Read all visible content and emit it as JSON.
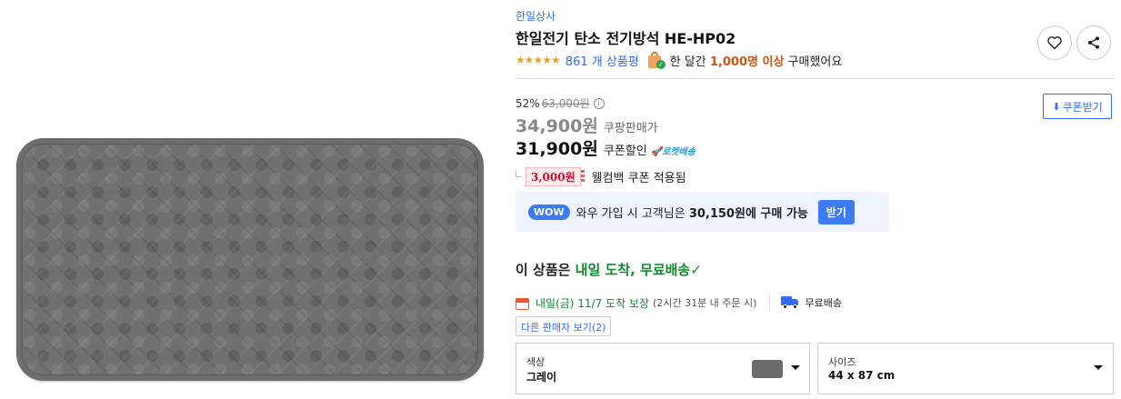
{
  "product": {
    "brand": "한일상사",
    "title": "한일전기 탄소 전기방석 HE-HP02",
    "rating_stars": "★★★★★",
    "review_count": "861 개 상품평",
    "purchase_prefix": "한 달간",
    "purchase_highlight": "1,000명 이상",
    "purchase_suffix": "구매했어요"
  },
  "actions": {
    "wishlist_icon": "heart-icon",
    "share_icon": "share-icon"
  },
  "pricing": {
    "discount_rate": "52%",
    "original_price": "63,000원",
    "coupang_price": "34,900원",
    "coupang_price_label": "쿠팡판매가",
    "coupon_price": "31,900원",
    "coupon_price_label": "쿠폰할인",
    "rocket_label": "🚀로켓배송",
    "coupon_button": "쿠폰받기",
    "cashback_amount": "3,000원",
    "cashback_text": "웰컴백 쿠폰 적용됨"
  },
  "wow": {
    "badge": "WOW",
    "text_prefix": "와우 가입 시 고객님은",
    "text_price": "30,150원에 구매 가능",
    "button": "받기"
  },
  "delivery": {
    "arrival_prefix": "이 상품은",
    "arrival_highlight": "내일 도착, 무료배송",
    "check": "✓",
    "date": "내일(금) 11/7 도착 보장",
    "note": "(2시간 31분 내 주문 시)",
    "free_shipping": "무료배송",
    "other_sellers": "다른 판매자 보기(2)"
  },
  "options": {
    "color_label": "색상",
    "color_value": "그레이",
    "size_label": "사이즈",
    "size_value": "44 x 87 cm"
  },
  "colors": {
    "accent": "#346aff",
    "green": "#0f8a2e",
    "orange": "#d3520b",
    "star": "#f29d1c"
  }
}
